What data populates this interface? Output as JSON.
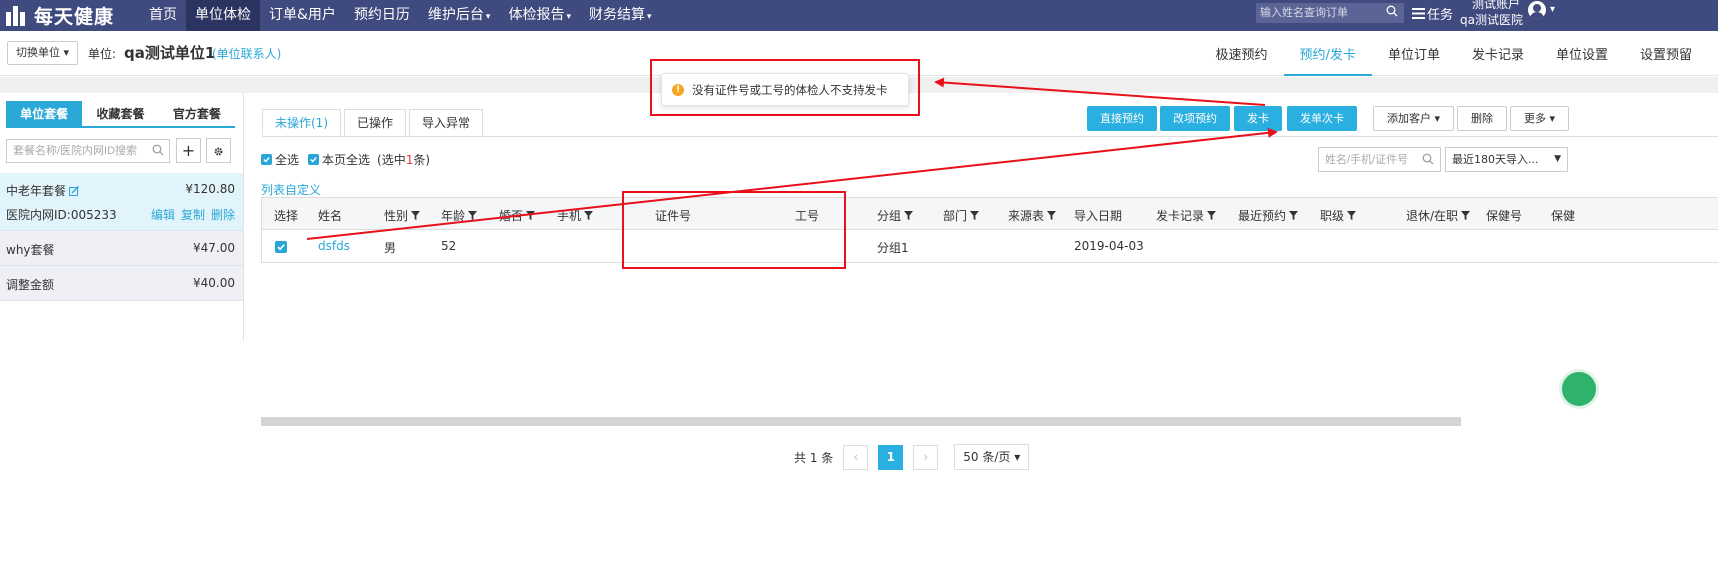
{
  "topbar": {
    "logo_text": "每天健康",
    "nav": [
      {
        "label": "首页",
        "active": false,
        "dropdown": false
      },
      {
        "label": "单位体检",
        "active": true,
        "dropdown": false
      },
      {
        "label": "订单&用户",
        "active": false,
        "dropdown": false
      },
      {
        "label": "预约日历",
        "active": false,
        "dropdown": false
      },
      {
        "label": "维护后台",
        "active": false,
        "dropdown": true
      },
      {
        "label": "体检报告",
        "active": false,
        "dropdown": true
      },
      {
        "label": "财务结算",
        "active": false,
        "dropdown": true
      }
    ],
    "search_placeholder": "输入姓名查询订单",
    "task_label": "任务",
    "user_name": "测试账户",
    "user_org": "qa测试医院"
  },
  "subhead": {
    "switch_label": "切换单位",
    "unit_prefix": "单位:",
    "unit_name": "qa测试单位1",
    "unit_contact": "(单位联系人)",
    "tabs": [
      {
        "label": "极速预约",
        "active": false
      },
      {
        "label": "预约/发卡",
        "active": true
      },
      {
        "label": "单位订单",
        "active": false
      },
      {
        "label": "发卡记录",
        "active": false
      },
      {
        "label": "单位设置",
        "active": false
      },
      {
        "label": "设置预留",
        "active": false
      }
    ]
  },
  "left": {
    "tabs": [
      {
        "label": "单位套餐",
        "active": true
      },
      {
        "label": "收藏套餐",
        "active": false
      },
      {
        "label": "官方套餐",
        "active": false
      }
    ],
    "search_placeholder": "套餐名称/医院内网ID搜索",
    "packages": [
      {
        "name": "中老年套餐",
        "price": "¥120.80",
        "id_text": "医院内网ID:005233",
        "actions": [
          "编辑",
          "复制",
          "删除"
        ]
      },
      {
        "name": "why套餐",
        "price": "¥47.00"
      },
      {
        "name": "调整金额",
        "price": "¥40.00"
      }
    ]
  },
  "main": {
    "tabs": [
      {
        "label": "未操作(1)",
        "active": true
      },
      {
        "label": "已操作",
        "active": false
      },
      {
        "label": "导入异常",
        "active": false
      }
    ],
    "buttons": {
      "direct_book": "直接预约",
      "change_book": "改项预约",
      "issue_card": "发卡",
      "issue_card_once": "发单次卡",
      "add_customer": "添加客户",
      "delete": "删除",
      "more": "更多"
    },
    "select_all": "全选",
    "select_page": "本页全选",
    "selected_prefix": "(选中",
    "selected_count": "1",
    "selected_suffix": "条)",
    "filter_placeholder": "姓名/手机/证件号",
    "range_value": "最近180天导入...",
    "column_custom": "列表自定义",
    "columns": {
      "select": "选择",
      "name": "姓名",
      "gender": "性别",
      "age": "年龄",
      "marriage": "婚否",
      "mobile": "手机",
      "id_no": "证件号",
      "emp_no": "工号",
      "group": "分组",
      "dept": "部门",
      "source": "来源表",
      "import_date": "导入日期",
      "card_record": "发卡记录",
      "recent_book": "最近预约",
      "rank": "职级",
      "retire": "退休/在职",
      "health_no": "保健号",
      "health_extra": "保健"
    },
    "rows": [
      {
        "name": "dsfds",
        "gender": "男",
        "age": "52",
        "id_no": "",
        "emp_no": "",
        "group": "分组1",
        "import_date": "2019-04-03"
      }
    ],
    "pager": {
      "total": "共 1 条",
      "current": "1",
      "page_size": "50 条/页"
    }
  },
  "alert": {
    "message": "没有证件号或工号的体检人不支持发卡"
  },
  "colors": {
    "nav_bg": "#3f4a7e",
    "accent": "#29b0e0",
    "annotation": "#e8101a",
    "warning": "#f5a623"
  }
}
